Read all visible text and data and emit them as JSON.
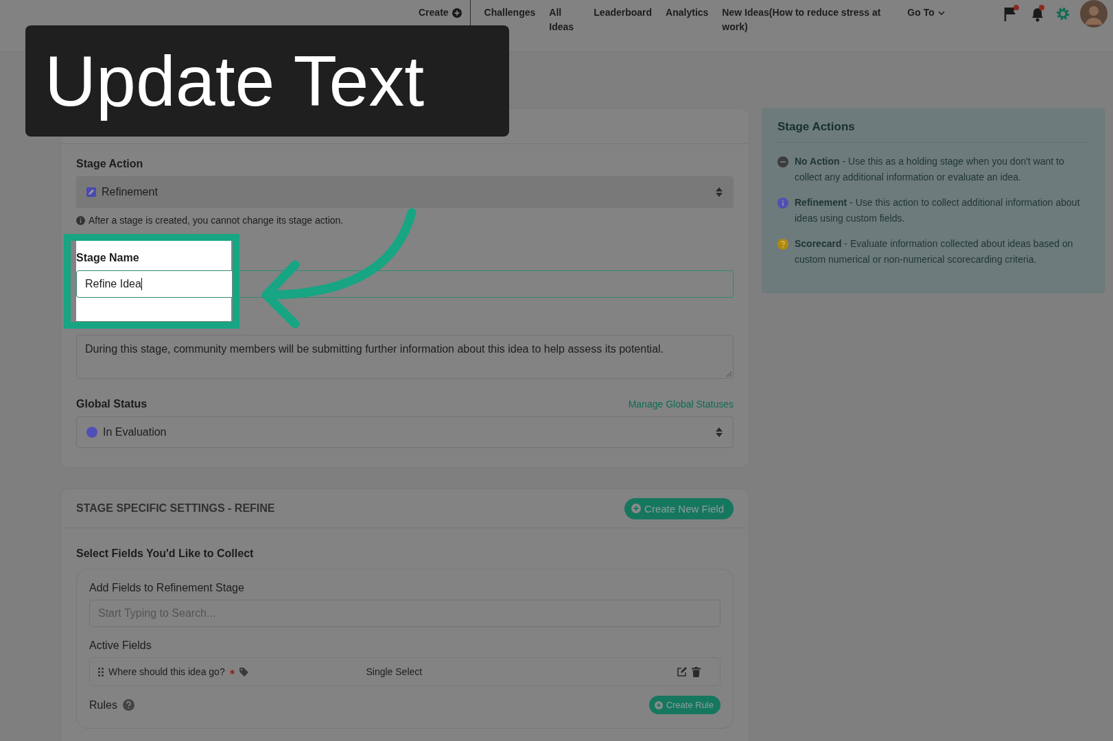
{
  "banner": {
    "text": "Update Text"
  },
  "nav": {
    "items": [
      {
        "label": "Create",
        "kind": "create"
      },
      {
        "label": "Challenges",
        "kind": "link"
      },
      {
        "label": "All Ideas",
        "kind": "link"
      },
      {
        "label": "Leaderboard",
        "kind": "link"
      },
      {
        "label": "Analytics",
        "kind": "link"
      },
      {
        "label": "New Ideas(How to reduce stress at work)",
        "kind": "link"
      },
      {
        "label": "Go To",
        "kind": "dropdown"
      }
    ]
  },
  "basic_info": {
    "stage_action": {
      "label": "Stage Action",
      "value": "Refinement",
      "note": "After a stage is created, you cannot change its stage action."
    },
    "stage_name": {
      "label": "Stage Name",
      "value": "Refine Idea"
    },
    "stage_description": {
      "value": "During this stage, community members will be submitting further information about this idea to help assess its potential."
    },
    "global_status": {
      "label": "Global Status",
      "link": "Manage Global Statuses",
      "value": "In Evaluation",
      "color": "#4f4fb8"
    }
  },
  "stage_actions": {
    "title": "Stage Actions",
    "items": [
      {
        "name": "No Action",
        "text": " - Use this as a holding stage when you don't want to collect any additional information or evaluate an idea.",
        "kind": "none",
        "color": "#3c3c3c"
      },
      {
        "name": "Refinement",
        "text": " - Use this action to collect additional information about ideas using custom fields.",
        "kind": "info",
        "color": "#5050b4"
      },
      {
        "name": "Scorecard",
        "text": " - Evaluate information collected about ideas based on custom numerical or non-numerical scorecarding criteria.",
        "kind": "question",
        "color": "#b08a10"
      }
    ]
  },
  "stage_settings": {
    "heading": "STAGE SPECIFIC SETTINGS - REFINE",
    "button": "Create New Field",
    "subheading": "Select Fields You'd Like to Collect",
    "add_label": "Add Fields to Refinement Stage",
    "placeholder": "Start Typing to Search...",
    "active_label": "Active Fields",
    "fields": [
      {
        "name": "Where should this idea go?",
        "required": true,
        "type": "Single Select"
      }
    ],
    "rules_label": "Rules",
    "rules_button": "Create Rule"
  }
}
